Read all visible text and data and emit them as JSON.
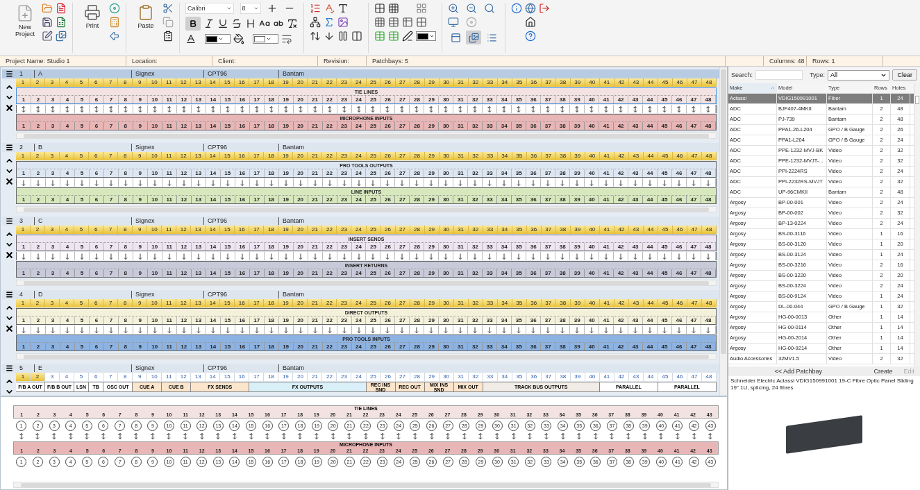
{
  "toolbar": {
    "new_project": "New Project",
    "print": "Print",
    "paste": "Paste",
    "font": "Calibri",
    "size": "8",
    "bold": true,
    "views": [
      {
        "selected": false
      },
      {
        "selected": true
      },
      {
        "selected": false
      }
    ]
  },
  "info_bar": [
    "Project Name: Studio 1",
    "Location:",
    "Client:",
    "Revision:",
    "Patchbays: 5"
  ],
  "grid_info": [
    "Columns: 48",
    "Rows: 1"
  ],
  "bays": [
    {
      "kind": "full",
      "number": "1",
      "name": "A",
      "make": "Signex",
      "model": "CPT96",
      "type": "Bantam",
      "selected": true,
      "half_normalled": false,
      "columns": [
        "1",
        "2",
        "3",
        "4",
        "5",
        "6",
        "7",
        "8",
        "9",
        "10",
        "11",
        "12",
        "13",
        "14",
        "15",
        "16",
        "17",
        "18",
        "19",
        "20",
        "21",
        "22",
        "23",
        "24",
        "25",
        "26",
        "27",
        "28",
        "29",
        "30",
        "31",
        "32",
        "33",
        "34",
        "35",
        "36",
        "37",
        "38",
        "39",
        "40",
        "41",
        "42",
        "43",
        "44",
        "45",
        "46",
        "47",
        "48"
      ],
      "top": {
        "title": "TIE LINES",
        "color": "#f2e2e2",
        "numbers": [
          "1",
          "2",
          "3",
          "4",
          "5",
          "6",
          "7",
          "8",
          "9",
          "10",
          "11",
          "12",
          "13",
          "14",
          "15",
          "16",
          "17",
          "18",
          "19",
          "20",
          "21",
          "22",
          "23",
          "24",
          "25",
          "26",
          "27",
          "28",
          "29",
          "30",
          "31",
          "32",
          "33",
          "34",
          "35",
          "36",
          "37",
          "38",
          "39",
          "40",
          "41",
          "42",
          "43",
          "44",
          "45",
          "46",
          "47",
          "48"
        ]
      },
      "bottom": {
        "title": "MICROPHONE INPUTS",
        "color": "#e8b6b6",
        "numbers": [
          "1",
          "2",
          "3",
          "4",
          "5",
          "6",
          "7",
          "8",
          "9",
          "10",
          "11",
          "12",
          "13",
          "14",
          "15",
          "16",
          "17",
          "18",
          "19",
          "20",
          "21",
          "22",
          "23",
          "24",
          "25",
          "26",
          "27",
          "28",
          "29",
          "30",
          "31",
          "32",
          "33",
          "34",
          "35",
          "36",
          "37",
          "38",
          "39",
          "40",
          "41",
          "42",
          "43",
          "44",
          "45",
          "46",
          "47",
          "48"
        ]
      }
    },
    {
      "kind": "full",
      "number": "2",
      "name": "B",
      "make": "Signex",
      "model": "CPT96",
      "type": "Bantam",
      "selected": false,
      "half_normalled": true,
      "columns": [
        "1",
        "2",
        "3",
        "4",
        "5",
        "6",
        "7",
        "8",
        "9",
        "10",
        "11",
        "12",
        "13",
        "14",
        "15",
        "16",
        "17",
        "18",
        "19",
        "20",
        "21",
        "22",
        "23",
        "24",
        "25",
        "26",
        "27",
        "28",
        "29",
        "30",
        "31",
        "32",
        "33",
        "34",
        "35",
        "36",
        "37",
        "38",
        "39",
        "40",
        "41",
        "42",
        "43",
        "44",
        "45",
        "46",
        "47",
        "48"
      ],
      "top": {
        "title": "PRO TOOLS OUTPUTS",
        "color": "#dde7f3",
        "numbers": [
          "1",
          "2",
          "3",
          "4",
          "5",
          "6",
          "7",
          "8",
          "9",
          "10",
          "11",
          "12",
          "13",
          "14",
          "15",
          "16",
          "17",
          "18",
          "19",
          "20",
          "21",
          "22",
          "23",
          "24",
          "25",
          "26",
          "27",
          "28",
          "29",
          "30",
          "31",
          "32",
          "33",
          "34",
          "35",
          "36",
          "37",
          "38",
          "39",
          "40",
          "41",
          "42",
          "43",
          "44",
          "45",
          "46",
          "47",
          "48"
        ]
      },
      "bottom": {
        "title": "LINE INPUTS",
        "color": "#d7e8bd",
        "numbers": [
          "1",
          "2",
          "3",
          "4",
          "5",
          "6",
          "7",
          "8",
          "9",
          "10",
          "11",
          "12",
          "13",
          "14",
          "15",
          "16",
          "17",
          "18",
          "19",
          "20",
          "21",
          "22",
          "23",
          "24",
          "25",
          "26",
          "27",
          "28",
          "29",
          "30",
          "31",
          "32",
          "33",
          "34",
          "35",
          "36",
          "37",
          "38",
          "39",
          "40",
          "41",
          "42",
          "43",
          "44",
          "45",
          "46",
          "47",
          "48"
        ]
      }
    },
    {
      "kind": "full",
      "number": "3",
      "name": "C",
      "make": "Signex",
      "model": "CPT96",
      "type": "Bantam",
      "selected": false,
      "half_normalled": true,
      "columns": [
        "1",
        "2",
        "3",
        "4",
        "5",
        "6",
        "7",
        "8",
        "9",
        "10",
        "11",
        "12",
        "13",
        "14",
        "15",
        "16",
        "17",
        "18",
        "19",
        "20",
        "21",
        "22",
        "23",
        "24",
        "25",
        "26",
        "27",
        "28",
        "29",
        "30",
        "31",
        "32",
        "33",
        "34",
        "35",
        "36",
        "37",
        "38",
        "39",
        "40",
        "41",
        "42",
        "43",
        "44",
        "45",
        "46",
        "47",
        "48"
      ],
      "top": {
        "title": "INSERT SENDS",
        "color": "#ede5f1",
        "numbers": [
          "1",
          "2",
          "3",
          "4",
          "5",
          "6",
          "7",
          "8",
          "9",
          "10",
          "11",
          "12",
          "13",
          "14",
          "15",
          "16",
          "17",
          "18",
          "19",
          "20",
          "21",
          "22",
          "23",
          "24",
          "25",
          "26",
          "27",
          "28",
          "29",
          "30",
          "31",
          "32",
          "33",
          "34",
          "35",
          "36",
          "37",
          "38",
          "39",
          "40",
          "41",
          "42",
          "43",
          "44",
          "45",
          "46",
          "47",
          "48"
        ]
      },
      "bottom": {
        "title": "INSERT RETURNS",
        "color": "#c9cad9",
        "numbers": [
          "1",
          "2",
          "3",
          "4",
          "5",
          "6",
          "7",
          "8",
          "9",
          "10",
          "11",
          "12",
          "13",
          "14",
          "15",
          "16",
          "17",
          "18",
          "19",
          "20",
          "21",
          "22",
          "23",
          "24",
          "25",
          "26",
          "27",
          "28",
          "29",
          "30",
          "31",
          "32",
          "33",
          "34",
          "35",
          "36",
          "37",
          "38",
          "39",
          "40",
          "41",
          "42",
          "43",
          "44",
          "45",
          "46",
          "47",
          "48"
        ]
      }
    },
    {
      "kind": "full",
      "number": "4",
      "name": "D",
      "make": "Signex",
      "model": "CPT96",
      "type": "Bantam",
      "selected": false,
      "half_normalled": true,
      "columns": [
        "1",
        "2",
        "3",
        "4",
        "5",
        "6",
        "7",
        "8",
        "9",
        "10",
        "11",
        "12",
        "13",
        "14",
        "15",
        "16",
        "17",
        "18",
        "19",
        "20",
        "21",
        "22",
        "23",
        "24",
        "25",
        "26",
        "27",
        "28",
        "29",
        "30",
        "31",
        "32",
        "33",
        "34",
        "35",
        "36",
        "37",
        "38",
        "39",
        "40",
        "41",
        "42",
        "43",
        "44",
        "45",
        "46",
        "47",
        "48"
      ],
      "top": {
        "title": "DIRECT OUTPUTS",
        "color": "#f3f1da",
        "numbers": [
          "1",
          "2",
          "3",
          "4",
          "5",
          "6",
          "7",
          "8",
          "9",
          "10",
          "11",
          "12",
          "13",
          "14",
          "15",
          "16",
          "17",
          "18",
          "19",
          "20",
          "21",
          "22",
          "23",
          "24",
          "25",
          "26",
          "27",
          "28",
          "29",
          "30",
          "31",
          "32",
          "33",
          "34",
          "35",
          "36",
          "37",
          "38",
          "39",
          "40",
          "41",
          "42",
          "43",
          "44",
          "45",
          "46",
          "47",
          "48"
        ]
      },
      "bottom": {
        "title": "PRO TOOLS INPUTS",
        "color": "#8db3e2",
        "numbers": [
          "1",
          "2",
          "3",
          "4",
          "5",
          "6",
          "7",
          "8",
          "9",
          "10",
          "11",
          "12",
          "13",
          "14",
          "15",
          "16",
          "17",
          "18",
          "19",
          "20",
          "21",
          "22",
          "23",
          "24",
          "25",
          "26",
          "27",
          "28",
          "29",
          "30",
          "31",
          "32",
          "33",
          "34",
          "35",
          "36",
          "37",
          "38",
          "39",
          "40",
          "41",
          "42",
          "43",
          "44",
          "45",
          "46",
          "47",
          "48"
        ]
      }
    },
    {
      "kind": "labels",
      "number": "5",
      "name": "E",
      "make": "Signex",
      "model": "CPT96",
      "type": "Bantam",
      "selected": false,
      "columns": [
        {
          "label": "1",
          "selected": true
        },
        {
          "label": "2",
          "selected": true
        },
        {
          "label": "3",
          "selected": false
        },
        {
          "label": "4",
          "selected": false
        },
        {
          "label": "5",
          "selected": false
        },
        {
          "label": "6",
          "selected": false
        },
        {
          "label": "7",
          "selected": false
        },
        {
          "label": "8",
          "selected": false
        },
        {
          "label": "9",
          "selected": false
        },
        {
          "label": "10",
          "selected": false
        },
        {
          "label": "11",
          "selected": false
        },
        {
          "label": "12",
          "selected": false
        },
        {
          "label": "13",
          "selected": false
        },
        {
          "label": "14",
          "selected": false
        },
        {
          "label": "15",
          "selected": false
        },
        {
          "label": "16",
          "selected": false
        },
        {
          "label": "17",
          "selected": false
        },
        {
          "label": "18",
          "selected": false
        },
        {
          "label": "19",
          "selected": false
        },
        {
          "label": "20",
          "selected": false
        },
        {
          "label": "21",
          "selected": false
        },
        {
          "label": "22",
          "selected": false
        },
        {
          "label": "23",
          "selected": false
        },
        {
          "label": "24",
          "selected": false
        },
        {
          "label": "25",
          "selected": false
        },
        {
          "label": "26",
          "selected": false
        },
        {
          "label": "27",
          "selected": false
        },
        {
          "label": "28",
          "selected": false
        },
        {
          "label": "29",
          "selected": false
        },
        {
          "label": "30",
          "selected": false
        },
        {
          "label": "31",
          "selected": false
        },
        {
          "label": "32",
          "selected": false
        },
        {
          "label": "33",
          "selected": false
        },
        {
          "label": "34",
          "selected": false
        },
        {
          "label": "35",
          "selected": false
        },
        {
          "label": "36",
          "selected": false
        },
        {
          "label": "37",
          "selected": false
        },
        {
          "label": "38",
          "selected": false
        },
        {
          "label": "39",
          "selected": false
        },
        {
          "label": "40",
          "selected": false
        },
        {
          "label": "41",
          "selected": false
        },
        {
          "label": "42",
          "selected": false
        },
        {
          "label": "43",
          "selected": false
        },
        {
          "label": "44",
          "selected": false
        },
        {
          "label": "45",
          "selected": false
        },
        {
          "label": "46",
          "selected": false
        },
        {
          "label": "47",
          "selected": false
        },
        {
          "label": "48",
          "selected": false
        }
      ],
      "labels": [
        {
          "text": "F/B A OUT",
          "color": "#ffffff"
        },
        {
          "text": "F/B B OUT",
          "color": "#ffffff"
        },
        {
          "text": "LSN",
          "color": "#ffffff"
        },
        {
          "text": "TB",
          "color": "#ffffff"
        },
        {
          "text": "OSC OUT",
          "color": "#ffffff"
        },
        {
          "text": "CUE A",
          "color": "#fbe5cc"
        },
        {
          "text": "CUE B",
          "color": "#fbe5cc"
        },
        {
          "text": "FX SENDS",
          "color": "#fbe5cc"
        },
        {
          "text": "FX OUTPUTS",
          "color": "#daf0f8"
        },
        {
          "text": "REC INS SND",
          "color": "#fbe5cc"
        },
        {
          "text": "REC OUT",
          "color": "#fbe5cc"
        },
        {
          "text": "MIX INS SND",
          "color": "#fbe5cc"
        },
        {
          "text": "MIX OUT",
          "color": "#fbe5cc"
        },
        {
          "text": "TRACK BUS OUTPUTS",
          "color": "#f1ede6"
        },
        {
          "text": "PARALLEL",
          "color": "#ffffff"
        },
        {
          "text": "PARALLEL",
          "color": "#ffffff"
        }
      ]
    }
  ],
  "detail": {
    "strips": [
      {
        "title": "TIE LINES",
        "color": "#f2e2e2",
        "normalled": true,
        "numbers": [
          "1",
          "2",
          "3",
          "4",
          "5",
          "6",
          "7",
          "8",
          "9",
          "10",
          "11",
          "12",
          "13",
          "14",
          "15",
          "16",
          "17",
          "18",
          "19",
          "20",
          "21",
          "22",
          "23",
          "24",
          "25",
          "26",
          "27",
          "28",
          "29",
          "30",
          "31",
          "32",
          "33",
          "34",
          "35",
          "36",
          "37",
          "38",
          "39",
          "40",
          "41",
          "42",
          "43"
        ],
        "jacks": [
          "1",
          "2",
          "3",
          "4",
          "5",
          "6",
          "7",
          "8",
          "9",
          "10",
          "11",
          "12",
          "13",
          "14",
          "15",
          "16",
          "17",
          "18",
          "19",
          "20",
          "21",
          "22",
          "23",
          "24",
          "25",
          "26",
          "27",
          "28",
          "29",
          "30",
          "31",
          "32",
          "33",
          "34",
          "35",
          "36",
          "37",
          "38",
          "39",
          "40",
          "41",
          "42",
          "43"
        ]
      },
      {
        "title": "MICROPHONE INPUTS",
        "color": "#e8b6b6",
        "numbers": [
          "1",
          "2",
          "3",
          "4",
          "5",
          "6",
          "7",
          "8",
          "9",
          "10",
          "11",
          "12",
          "13",
          "14",
          "15",
          "16",
          "17",
          "18",
          "19",
          "20",
          "21",
          "22",
          "23",
          "24",
          "25",
          "26",
          "27",
          "28",
          "29",
          "30",
          "31",
          "32",
          "33",
          "34",
          "35",
          "36",
          "37",
          "38",
          "39",
          "40",
          "41",
          "42",
          "43"
        ],
        "jacks": [
          "1",
          "2",
          "3",
          "4",
          "5",
          "6",
          "7",
          "8",
          "9",
          "10",
          "11",
          "12",
          "13",
          "14",
          "15",
          "16",
          "17",
          "18",
          "19",
          "20",
          "21",
          "22",
          "23",
          "24",
          "25",
          "26",
          "27",
          "28",
          "29",
          "30",
          "31",
          "32",
          "33",
          "34",
          "35",
          "36",
          "37",
          "38",
          "39",
          "40",
          "41",
          "42",
          "43"
        ]
      }
    ]
  },
  "library": {
    "search_label": "Search:",
    "type_label": "Type:",
    "type_value": "All",
    "clear": "Clear",
    "columns": [
      {
        "label": "Make",
        "sorted": true
      },
      {
        "label": "Model",
        "sorted": false
      },
      {
        "label": "Type",
        "sorted": false
      },
      {
        "label": "Rows",
        "sorted": false
      },
      {
        "label": "Holes",
        "sorted": false
      }
    ],
    "rows": [
      {
        "cells": [
          "Actassi",
          "VDIG150991001",
          "Fiber",
          "1",
          "24"
        ],
        "selected": true
      },
      {
        "cells": [
          "ADC",
          "BJF407-4MKII",
          "Bantam",
          "2",
          "48"
        ],
        "selected": false
      },
      {
        "cells": [
          "ADC",
          "PJ-739",
          "Bantam",
          "2",
          "48"
        ],
        "selected": false
      },
      {
        "cells": [
          "ADC",
          "PPA1-26-L204",
          "GPO / B Gauge",
          "2",
          "26"
        ],
        "selected": false
      },
      {
        "cells": [
          "ADC",
          "PPA1-L204",
          "GPO / B Gauge",
          "2",
          "24"
        ],
        "selected": false
      },
      {
        "cells": [
          "ADC",
          "PPE-1232-MVJ-BK",
          "Video",
          "2",
          "32"
        ],
        "selected": false
      },
      {
        "cells": [
          "ADC",
          "PPE-1232-MVJT-...",
          "Video",
          "2",
          "32"
        ],
        "selected": false
      },
      {
        "cells": [
          "ADC",
          "PPI-2224RS",
          "Video",
          "2",
          "24"
        ],
        "selected": false
      },
      {
        "cells": [
          "ADC",
          "PPI-2232RS-MVJT",
          "Video",
          "2",
          "32"
        ],
        "selected": false
      },
      {
        "cells": [
          "ADC",
          "UP-96CMKII",
          "Bantam",
          "2",
          "48"
        ],
        "selected": false
      },
      {
        "cells": [
          "Argosy",
          "BP-00-001",
          "Video",
          "2",
          "24"
        ],
        "selected": false
      },
      {
        "cells": [
          "Argosy",
          "BP-00-002",
          "Video",
          "2",
          "32"
        ],
        "selected": false
      },
      {
        "cells": [
          "Argosy",
          "BP-13-0224",
          "Video",
          "2",
          "24"
        ],
        "selected": false
      },
      {
        "cells": [
          "Argosy",
          "BS-00-3116",
          "Video",
          "1",
          "16"
        ],
        "selected": false
      },
      {
        "cells": [
          "Argosy",
          "BS-00-3120",
          "Video",
          "1",
          "20"
        ],
        "selected": false
      },
      {
        "cells": [
          "Argosy",
          "BS-00-3124",
          "Video",
          "1",
          "24"
        ],
        "selected": false
      },
      {
        "cells": [
          "Argosy",
          "BS-00-3216",
          "Video",
          "2",
          "16"
        ],
        "selected": false
      },
      {
        "cells": [
          "Argosy",
          "BS-00-3220",
          "Video",
          "2",
          "20"
        ],
        "selected": false
      },
      {
        "cells": [
          "Argosy",
          "BS-00-3224",
          "Video",
          "2",
          "24"
        ],
        "selected": false
      },
      {
        "cells": [
          "Argosy",
          "BS-00-9124",
          "Video",
          "1",
          "24"
        ],
        "selected": false
      },
      {
        "cells": [
          "Argosy",
          "DL-00-044",
          "GPO / B Gauge",
          "1",
          "32"
        ],
        "selected": false
      },
      {
        "cells": [
          "Argosy",
          "HG-00-0013",
          "Other",
          "1",
          "14"
        ],
        "selected": false
      },
      {
        "cells": [
          "Argosy",
          "HG-00-0114",
          "Other",
          "1",
          "14"
        ],
        "selected": false
      },
      {
        "cells": [
          "Argosy",
          "HG-00-2014",
          "Other",
          "1",
          "14"
        ],
        "selected": false
      },
      {
        "cells": [
          "Argosy",
          "HG-00-9214",
          "Other",
          "1",
          "14"
        ],
        "selected": false
      },
      {
        "cells": [
          "Audio Accessories",
          "32MV1.5",
          "Video",
          "2",
          "32"
        ],
        "selected": false
      }
    ],
    "add": "<< Add Patchbay",
    "create": {
      "label": "Create",
      "disabled": false
    },
    "edit": {
      "label": "Edit",
      "disabled": true
    },
    "description": "Schneider Electric Actassi VDIG150991001 19-C Fibre Optic Panel Sliding 19\" 1U, splicing, 24 fibres"
  }
}
